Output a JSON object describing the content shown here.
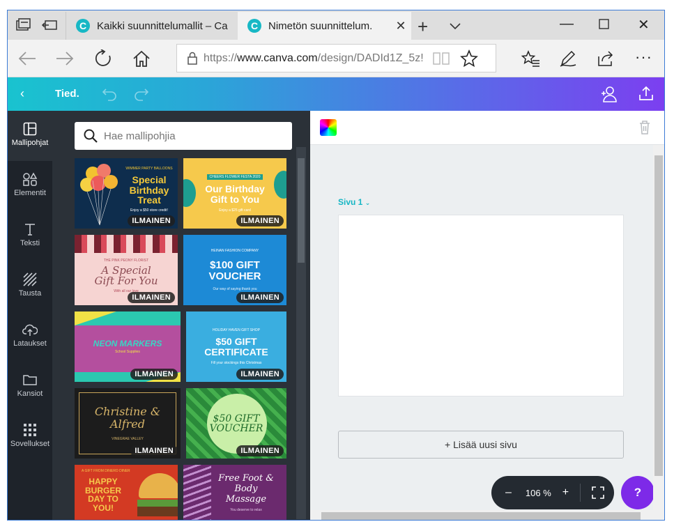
{
  "browser": {
    "tabs": [
      {
        "title": "Kaikki suunnittelumallit – Ca",
        "active": false
      },
      {
        "title": "Nimetön suunnittelum.",
        "active": true
      }
    ],
    "url_prefix": "https://",
    "url_host": "www.canva.com",
    "url_path": "/design/DADId1Z_5z!"
  },
  "toolbar": {
    "file_label": "Tied."
  },
  "sidebar": {
    "items": [
      {
        "label": "Mallipohjat",
        "icon": "templates-icon",
        "active": true
      },
      {
        "label": "Elementit",
        "icon": "elements-icon"
      },
      {
        "label": "Teksti",
        "icon": "text-icon"
      },
      {
        "label": "Tausta",
        "icon": "background-icon"
      },
      {
        "label": "Lataukset",
        "icon": "upload-icon"
      },
      {
        "label": "Kansiot",
        "icon": "folder-icon"
      },
      {
        "label": "Sovellukset",
        "icon": "apps-icon"
      }
    ]
  },
  "panel": {
    "search_placeholder": "Hae mallipohjia",
    "badge": "ILMAINEN",
    "templates": [
      {
        "title": "Special Birthday Treat",
        "top": "WIMMER PARTY BALLOONS",
        "sub": "Enjoy a $50 store credit!"
      },
      {
        "title": "Our Birthday Gift to You",
        "top": "CHEERS FLOWER FESTA 2020",
        "sub": "Enjoy a $25 gift card"
      },
      {
        "title": "A Special Gift For You",
        "top": "THE PINK PEONY FLORIST",
        "sub": "With all our love"
      },
      {
        "title": "$100 GIFT VOUCHER",
        "top": "HEINAN FASHION COMPANY",
        "sub": "Our way of saying thank you"
      },
      {
        "title": "NEON MARKERS",
        "top": "",
        "sub": "School Supplies"
      },
      {
        "title": "$50 GIFT CERTIFICATE",
        "top": "HOLIDAY HAVEN GIFT SHOP",
        "sub": "Fill your stockings this Christmas"
      },
      {
        "title": "Christine & Alfred",
        "top": "",
        "sub": "VINEGRAE VALLEY"
      },
      {
        "title": "$50 GIFT VOUCHER",
        "top": "",
        "sub": ""
      },
      {
        "title": "HAPPY BURGER DAY TO YOU!",
        "top": "A GIFT FROM DINERO DINER",
        "sub": ""
      },
      {
        "title": "Free Foot & Body Massage",
        "top": "",
        "sub": "You deserve to relax"
      }
    ]
  },
  "editor": {
    "page_label": "Sivu 1",
    "add_page_label": "+ Lisää uusi sivu",
    "zoom": {
      "minus": "–",
      "value": "106 %",
      "plus": "+"
    },
    "help": "?"
  }
}
